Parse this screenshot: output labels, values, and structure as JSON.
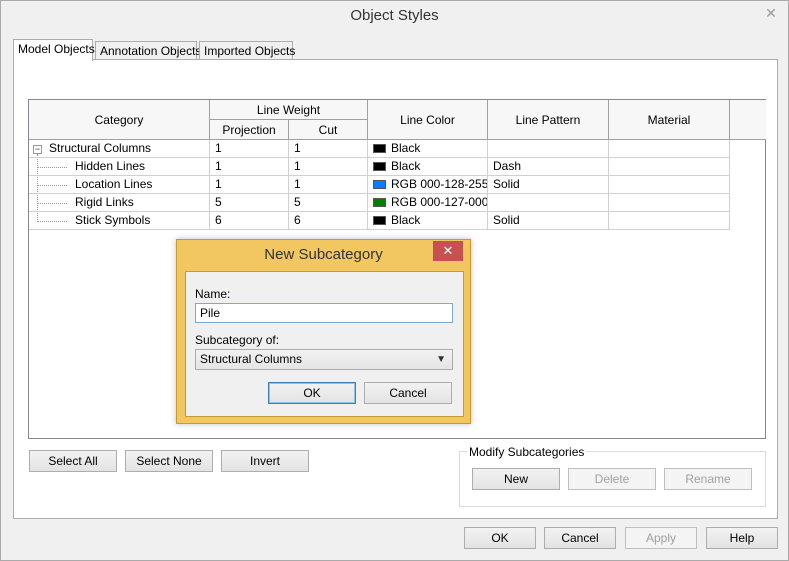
{
  "window": {
    "title": "Object Styles",
    "close_glyph": "✕"
  },
  "tabs": [
    {
      "label": "Model Objects",
      "active": true
    },
    {
      "label": "Annotation Objects",
      "active": false
    },
    {
      "label": "Imported Objects",
      "active": false
    }
  ],
  "grid": {
    "headers": {
      "category": "Category",
      "line_weight": "Line Weight",
      "projection": "Projection",
      "cut": "Cut",
      "line_color": "Line Color",
      "line_pattern": "Line Pattern",
      "material": "Material"
    },
    "rows": [
      {
        "category": "Structural Columns",
        "projection": "1",
        "cut": "1",
        "color_name": "Black",
        "color_hex": "#000000",
        "pattern": "",
        "material": "",
        "level": 0,
        "expander": "−"
      },
      {
        "category": "Hidden Lines",
        "projection": "1",
        "cut": "1",
        "color_name": "Black",
        "color_hex": "#000000",
        "pattern": "Dash",
        "material": "",
        "level": 1
      },
      {
        "category": "Location Lines",
        "projection": "1",
        "cut": "1",
        "color_name": "RGB 000-128-255",
        "color_hex": "#0080ff",
        "pattern": "Solid",
        "material": "",
        "level": 1
      },
      {
        "category": "Rigid Links",
        "projection": "5",
        "cut": "5",
        "color_name": "RGB 000-127-000",
        "color_hex": "#007f00",
        "pattern": "",
        "material": "",
        "level": 1
      },
      {
        "category": "Stick Symbols",
        "projection": "6",
        "cut": "6",
        "color_name": "Black",
        "color_hex": "#000000",
        "pattern": "Solid",
        "material": "",
        "level": 1
      }
    ]
  },
  "selection_buttons": {
    "select_all": "Select All",
    "select_none": "Select None",
    "invert": "Invert"
  },
  "modify_subcategories": {
    "label": "Modify Subcategories",
    "new": "New",
    "delete": "Delete",
    "rename": "Rename"
  },
  "footer": {
    "ok": "OK",
    "cancel": "Cancel",
    "apply": "Apply",
    "help": "Help"
  },
  "dialog": {
    "title": "New Subcategory",
    "close_glyph": "✕",
    "name_label": "Name:",
    "name_value": "Pile",
    "subcategory_of_label": "Subcategory of:",
    "subcategory_of_value": "Structural Columns",
    "ok": "OK",
    "cancel": "Cancel"
  },
  "colors": {
    "dialog_frame": "#f2c660",
    "dialog_close": "#c75050"
  }
}
